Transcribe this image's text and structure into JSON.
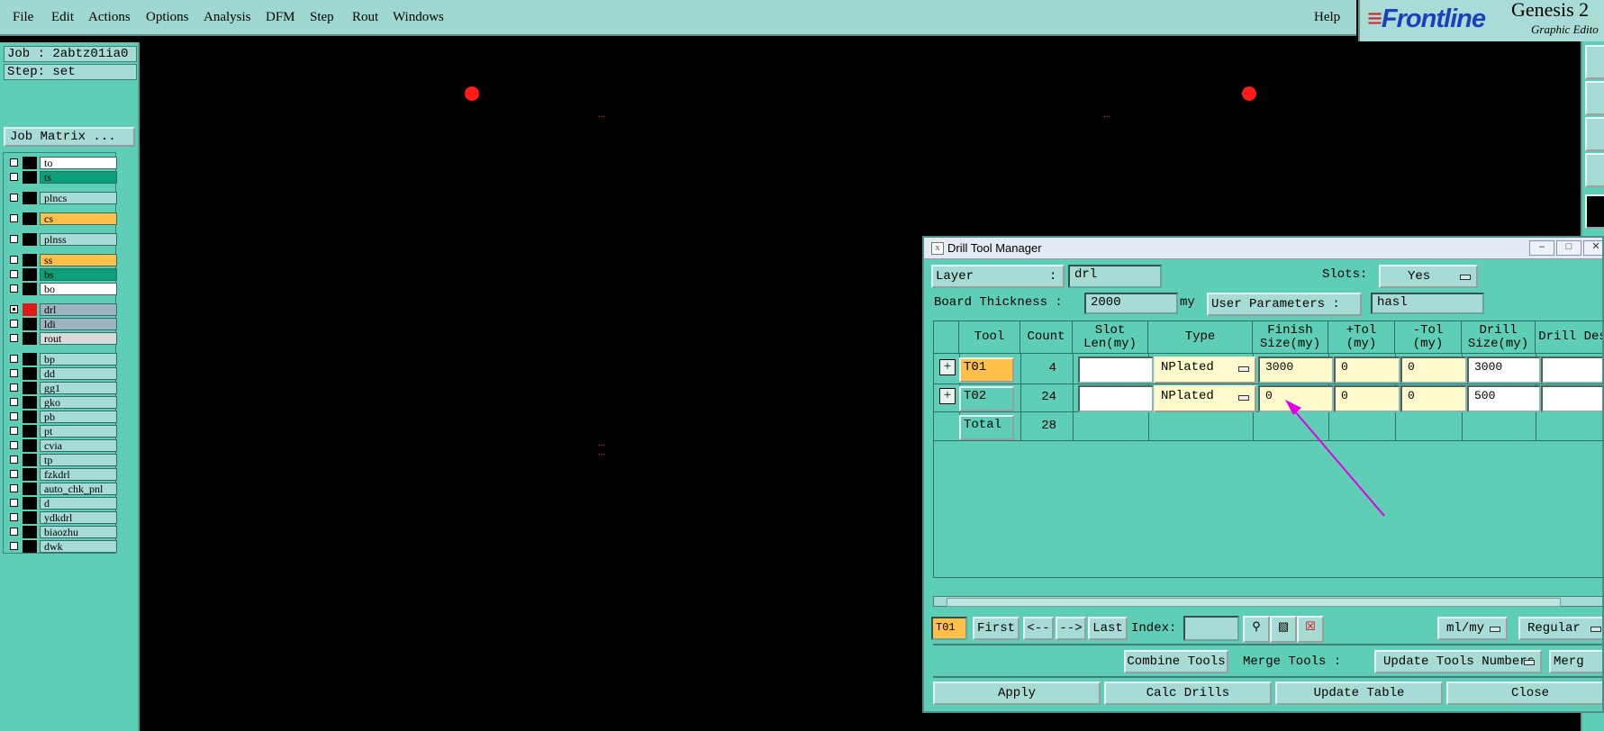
{
  "menubar": {
    "items": [
      "File",
      "Edit",
      "Actions",
      "Options",
      "Analysis",
      "DFM",
      "Step",
      "Rout",
      "Windows"
    ],
    "help": "Help"
  },
  "brand": {
    "logo": "Frontline",
    "product": "Genesis 2",
    "subtitle": "Graphic Edito"
  },
  "job": {
    "job_label": "Job : 2abtz01ia0",
    "step_label": "Step: set",
    "matrix_button": "Job Matrix ..."
  },
  "layers": [
    {
      "name": "to",
      "color": "#ffffff",
      "checked": false,
      "group": 0
    },
    {
      "name": "ts",
      "color": "#0aa07a",
      "checked": false,
      "group": 0
    },
    {
      "name": "plncs",
      "color": "#a7dcd6",
      "checked": false,
      "group": 1
    },
    {
      "name": "cs",
      "color": "#ffc04a",
      "checked": false,
      "group": 2
    },
    {
      "name": "plnss",
      "color": "#a7dcd6",
      "checked": false,
      "group": 3
    },
    {
      "name": "ss",
      "color": "#ffc04a",
      "checked": false,
      "group": 4
    },
    {
      "name": "bs",
      "color": "#0aa07a",
      "checked": false,
      "group": 4
    },
    {
      "name": "bo",
      "color": "#ffffff",
      "checked": false,
      "group": 4
    },
    {
      "name": "drl",
      "color": "#9db4c0",
      "checked": true,
      "group": 5
    },
    {
      "name": "ldi",
      "color": "#9db4c0",
      "checked": false,
      "group": 5
    },
    {
      "name": "rout",
      "color": "#d8dadc",
      "checked": false,
      "group": 5
    },
    {
      "name": "bp",
      "color": "#a7dcd6",
      "checked": false,
      "group": 6
    },
    {
      "name": "dd",
      "color": "#a7dcd6",
      "checked": false,
      "group": 6
    },
    {
      "name": "gg1",
      "color": "#a7dcd6",
      "checked": false,
      "group": 6
    },
    {
      "name": "gko",
      "color": "#a7dcd6",
      "checked": false,
      "group": 6
    },
    {
      "name": "pb",
      "color": "#a7dcd6",
      "checked": false,
      "group": 6
    },
    {
      "name": "pt",
      "color": "#a7dcd6",
      "checked": false,
      "group": 6
    },
    {
      "name": "cvia",
      "color": "#a7dcd6",
      "checked": false,
      "group": 6
    },
    {
      "name": "tp",
      "color": "#a7dcd6",
      "checked": false,
      "group": 6
    },
    {
      "name": "fzkdrl",
      "color": "#a7dcd6",
      "checked": false,
      "group": 6
    },
    {
      "name": "auto_chk_pnl",
      "color": "#a7dcd6",
      "checked": false,
      "group": 6
    },
    {
      "name": "d",
      "color": "#a7dcd6",
      "checked": false,
      "group": 6
    },
    {
      "name": "ydkdrl",
      "color": "#a7dcd6",
      "checked": false,
      "group": 6
    },
    {
      "name": "biaozhu",
      "color": "#a7dcd6",
      "checked": false,
      "group": 6
    },
    {
      "name": "dwk",
      "color": "#a7dcd6",
      "checked": false,
      "group": 6
    }
  ],
  "canvas": {
    "dots": "...",
    "pad_color": "#ff1a1a"
  },
  "dialog": {
    "title": "Drill Tool Manager",
    "layer_label": "Layer          :",
    "layer_value": "drl",
    "slots_label": "Slots:",
    "slots_value": "Yes",
    "thickness_label": "Board Thickness :",
    "thickness_value": "2000",
    "thickness_unit": "my",
    "user_params_label": "User Parameters :",
    "user_params_value": "hasl",
    "headers": [
      "Tool",
      "Count",
      "Slot Len(my)",
      "Type",
      "Finish Size(my)",
      "+Tol (my)",
      "-Tol (my)",
      "Drill Size(my)",
      "Drill Des"
    ],
    "rows": [
      {
        "tool": "T01",
        "count": "4",
        "slot_len": "",
        "type": "NPlated",
        "finish": "3000",
        "ptol": "0",
        "mtol": "0",
        "drill": "3000",
        "des": "",
        "tool_color": "#ffc04a"
      },
      {
        "tool": "T02",
        "count": "24",
        "slot_len": "",
        "type": "NPlated",
        "finish": "0",
        "ptol": "0",
        "mtol": "0",
        "drill": "500",
        "des": "",
        "tool_color": "#5ecfb6"
      }
    ],
    "total_label": "Total",
    "total_count": "28",
    "nav": {
      "current": "T01",
      "first": "First",
      "prev": "<--",
      "next": "-->",
      "last": "Last",
      "index_label": "Index:",
      "index_value": "",
      "units": "ml/my",
      "mode": "Regular"
    },
    "combine": "Combine Tools",
    "merge_label": "Merge Tools :",
    "update_numbers": "Update Tools Numbers",
    "merge_more": "Merg",
    "apply": "Apply",
    "calc": "Calc Drills",
    "update_table": "Update Table",
    "close": "Close"
  },
  "annotation_color": "#e000e0"
}
